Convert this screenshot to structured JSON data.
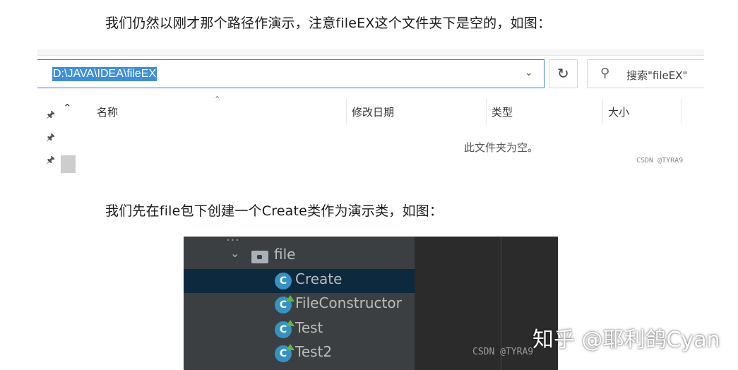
{
  "paragraph1": "我们仍然以刚才那个路径作演示，注意fileEX这个文件夹下是空的，如图：",
  "paragraph2": "我们先在file包下创建一个Create类作为演示类，如图：",
  "explorer": {
    "address": "D:\\JAVA\\IDEA\\fileEX",
    "search_placeholder": "搜索\"fileEX\"",
    "columns": [
      "名称",
      "修改日期",
      "类型",
      "大小"
    ],
    "empty_message": "此文件夹为空。",
    "watermark": "CSDN @TYRA9"
  },
  "ide": {
    "top_partial": "...",
    "package": "file",
    "classes": [
      "Create",
      "FileConstructor",
      "Test",
      "Test2"
    ],
    "selected": "Create",
    "watermark": "CSDN @TYRA9"
  },
  "site_watermark": "知乎 @耶利鸽Cyan",
  "colors": {
    "accent_blue": "#3d8fdb",
    "ide_bg": "#3c3f41",
    "ide_selection": "#0d293e",
    "class_icon": "#3592c4"
  }
}
